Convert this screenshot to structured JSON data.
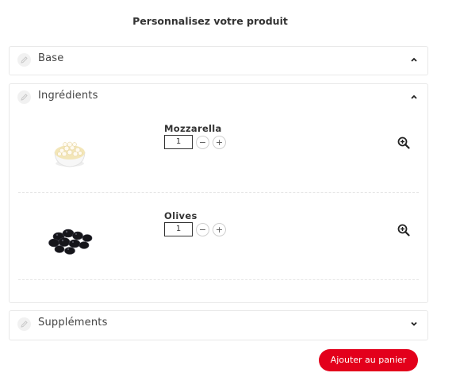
{
  "page": {
    "title": "Personnalisez votre produit"
  },
  "sections": {
    "base": {
      "label": "Base",
      "chevron": "chevron-up-icon"
    },
    "ingredients": {
      "label": "Ingrédients",
      "chevron": "chevron-up-icon",
      "items": [
        {
          "name": "Mozzarella",
          "quantity": "1",
          "minus": "−",
          "plus": "+",
          "image": "mozzarella-bowl"
        },
        {
          "name": "Olives",
          "quantity": "1",
          "minus": "−",
          "plus": "+",
          "image": "black-olives"
        }
      ]
    },
    "supplements": {
      "label": "Suppléments",
      "chevron": "chevron-down-icon"
    }
  },
  "cart": {
    "add_label": "Ajouter au panier"
  },
  "colors": {
    "accent": "#e3001b",
    "border": "#e8e8e8"
  }
}
